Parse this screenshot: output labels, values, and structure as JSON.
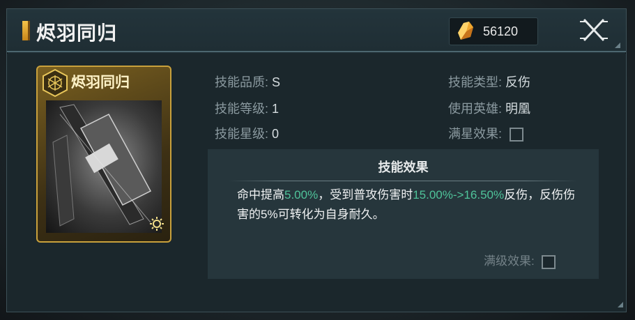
{
  "header": {
    "title": "烬羽同归",
    "currency": {
      "icon": "gold-crystal-icon",
      "value": "56120"
    },
    "close_icon": "close-icon"
  },
  "card": {
    "title": "烬羽同归",
    "emblem_icon": "hexagon-emblem-icon",
    "corner_icon": "sun-gear-icon"
  },
  "info": {
    "quality_label": "技能品质:",
    "quality_value": "S",
    "level_label": "技能等级:",
    "level_value": "1",
    "star_label": "技能星级:",
    "star_value": "0",
    "type_label": "技能类型:",
    "type_value": "反伤",
    "hero_label": "使用英雄:",
    "hero_value": "明凰",
    "full_star_label": "满星效果:"
  },
  "effect": {
    "title": "技能效果",
    "text_1": "命中提高",
    "hl_1": "5.00%",
    "text_2": "，受到普攻伤害时",
    "hl_2": "15.00%->16.50%",
    "text_3": "反伤，反伤伤害的5%可转化为自身耐久。",
    "max_level_label": "满级效果:"
  },
  "colors": {
    "accent_gold": "#c9a13c",
    "highlight_green": "#4fc39a",
    "panel_bg": "#1c2a30"
  }
}
